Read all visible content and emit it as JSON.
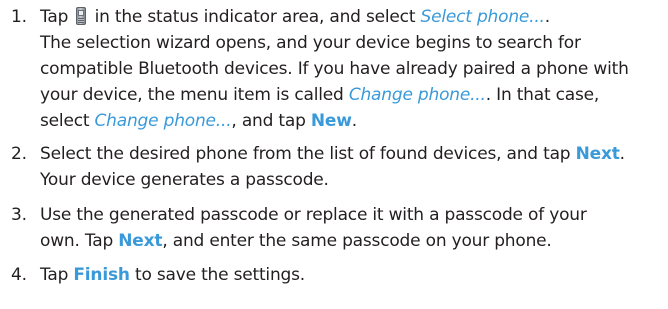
{
  "steps": [
    {
      "number": "1.",
      "line1_a": "Tap ",
      "icon": "phone-status-icon",
      "line1_b": " in the status indicator area, and select ",
      "line1_link": "Select phone...",
      "line1_c": ".",
      "line2": "The selection wizard opens, and your device begins to search for",
      "line3": "compatible Bluetooth devices. If you have already paired a phone with",
      "line4_a": "your device, the menu item is called ",
      "line4_link": "Change phone...",
      "line4_b": ". In that case,",
      "line5_a": "select ",
      "line5_link": "Change phone...",
      "line5_b": ", and tap ",
      "line5_kw": "New",
      "line5_c": "."
    },
    {
      "number": "2.",
      "line1_a": "Select the desired phone from the list of found devices, and tap ",
      "line1_kw": "Next",
      "line1_b": ".",
      "line2": "Your device generates a passcode."
    },
    {
      "number": "3.",
      "line1": "Use the generated passcode or replace it with a passcode of your",
      "line2_a": "own. Tap ",
      "line2_kw": "Next",
      "line2_b": ", and enter the same passcode on your phone."
    },
    {
      "number": "4.",
      "line1_a": "Tap ",
      "line1_kw": "Finish",
      "line1_b": " to save the settings."
    }
  ],
  "colors": {
    "text": "#231f20",
    "accent": "#3a9ad9"
  }
}
